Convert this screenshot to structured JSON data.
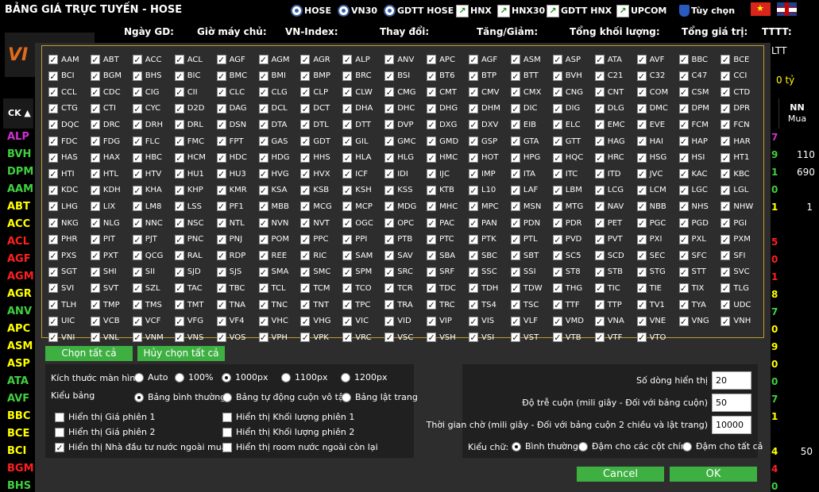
{
  "topbar": {
    "title": "BẢNG GIÁ TRỰC TUYẾN - HOSE",
    "nav": [
      {
        "label": "HOSE",
        "icon": "circle-logo-icon"
      },
      {
        "label": "VN30",
        "icon": "circle-logo-icon"
      },
      {
        "label": "GDTT HOSE",
        "icon": "circle-logo-icon"
      },
      {
        "label": "HNX",
        "icon": "chart-icon"
      },
      {
        "label": "HNX30",
        "icon": "chart-icon"
      },
      {
        "label": "GDTT HNX",
        "icon": "chart-icon"
      },
      {
        "label": "UPCOM",
        "icon": "chart-icon"
      },
      {
        "label": "Tùy chọn",
        "icon": "shield-icon"
      }
    ],
    "flags": [
      "vietnam-flag-icon",
      "uk-flag-icon"
    ]
  },
  "header": {
    "labels": [
      "Ngày GD:",
      "Giờ máy chủ:",
      "VN-Index:",
      "Thay đổi:",
      "Tăng/Giảm:",
      "Tổng khối lượng:",
      "Tổng giá trị:",
      "TTTT:"
    ],
    "ttlt": "LTT",
    "ty": "0 tỷ"
  },
  "logo": {
    "text": "VI"
  },
  "table": {
    "ck_header": "CK ▲",
    "nn_header": "NN",
    "nn_sub": "Mua",
    "rows": [
      {
        "ck": "ALP",
        "color": "#d030d0",
        "n": "7",
        "nc": "#d030d0",
        "v": ""
      },
      {
        "ck": "BVH",
        "color": "#40d040",
        "n": "9",
        "nc": "#40d040",
        "v": "110"
      },
      {
        "ck": "DPM",
        "color": "#40d040",
        "n": "1",
        "nc": "#40d040",
        "v": "690"
      },
      {
        "ck": "AAM",
        "color": "#40d040",
        "n": "0",
        "nc": "#40d040",
        "v": ""
      },
      {
        "ck": "ABT",
        "color": "#ffff00",
        "n": "1",
        "nc": "#ffff00",
        "v": "1"
      },
      {
        "ck": "ACC",
        "color": "#ffff00",
        "n": "",
        "nc": "#ffff00",
        "v": ""
      },
      {
        "ck": "ACL",
        "color": "#ff2020",
        "n": "5",
        "nc": "#ff2020",
        "v": ""
      },
      {
        "ck": "AGF",
        "color": "#ff2020",
        "n": "0",
        "nc": "#ff2020",
        "v": ""
      },
      {
        "ck": "AGM",
        "color": "#ff2020",
        "n": "1",
        "nc": "#ff2020",
        "v": ""
      },
      {
        "ck": "AGR",
        "color": "#ffff00",
        "n": "8",
        "nc": "#ffff00",
        "v": ""
      },
      {
        "ck": "ANV",
        "color": "#40d040",
        "n": "7",
        "nc": "#40d040",
        "v": ""
      },
      {
        "ck": "APC",
        "color": "#ffff00",
        "n": "0",
        "nc": "#ffff00",
        "v": ""
      },
      {
        "ck": "ASM",
        "color": "#ffff00",
        "n": "9",
        "nc": "#ffff00",
        "v": ""
      },
      {
        "ck": "ASP",
        "color": "#ffff00",
        "n": "0",
        "nc": "#ffff00",
        "v": ""
      },
      {
        "ck": "ATA",
        "color": "#40d040",
        "n": "0",
        "nc": "#40d040",
        "v": ""
      },
      {
        "ck": "AVF",
        "color": "#40d040",
        "n": "7",
        "nc": "#40d040",
        "v": ""
      },
      {
        "ck": "BBC",
        "color": "#ffff00",
        "n": "1",
        "nc": "#ffff00",
        "v": ""
      },
      {
        "ck": "BCE",
        "color": "#ffff00",
        "n": "",
        "nc": "#ffff00",
        "v": ""
      },
      {
        "ck": "BCI",
        "color": "#ffff00",
        "n": "4",
        "nc": "#ffff00",
        "v": "50"
      },
      {
        "ck": "BGM",
        "color": "#ff2020",
        "n": "4",
        "nc": "#ff2020",
        "v": ""
      },
      {
        "ck": "BHS",
        "color": "#40d040",
        "n": "0",
        "nc": "#40d040",
        "v": ""
      }
    ]
  },
  "modal": {
    "symbols": [
      "AAM",
      "ABT",
      "ACC",
      "ACL",
      "AGF",
      "AGM",
      "AGR",
      "ALP",
      "ANV",
      "APC",
      "AGF",
      "ASM",
      "ASP",
      "ATA",
      "AVF",
      "BBC",
      "BCE",
      "BCI",
      "BGM",
      "BHS",
      "BIC",
      "BMC",
      "BMI",
      "BMP",
      "BRC",
      "BSI",
      "BT6",
      "BTP",
      "BTT",
      "BVH",
      "C21",
      "C32",
      "C47",
      "CCI",
      "CCL",
      "CDC",
      "CIG",
      "CII",
      "CLC",
      "CLG",
      "CLP",
      "CLW",
      "CMG",
      "CMT",
      "CMV",
      "CMX",
      "CNG",
      "CNT",
      "COM",
      "CSM",
      "CTD",
      "CTG",
      "CTI",
      "CYC",
      "D2D",
      "DAG",
      "DCL",
      "DCT",
      "DHA",
      "DHC",
      "DHG",
      "DHM",
      "DIC",
      "DIG",
      "DLG",
      "DMC",
      "DPM",
      "DPR",
      "DQC",
      "DRC",
      "DRH",
      "DRL",
      "DSN",
      "DTA",
      "DTL",
      "DTT",
      "DVP",
      "DXG",
      "DXV",
      "EIB",
      "ELC",
      "EMC",
      "EVE",
      "FCM",
      "FCN",
      "FDC",
      "FDG",
      "FLC",
      "FMC",
      "FPT",
      "GAS",
      "GDT",
      "GIL",
      "GMC",
      "GMD",
      "GSP",
      "GTA",
      "GTT",
      "HAG",
      "HAI",
      "HAP",
      "HAR",
      "HAS",
      "HAX",
      "HBC",
      "HCM",
      "HDC",
      "HDG",
      "HHS",
      "HLA",
      "HLG",
      "HMC",
      "HOT",
      "HPG",
      "HQC",
      "HRC",
      "HSG",
      "HSI",
      "HT1",
      "HTI",
      "HTL",
      "HTV",
      "HU1",
      "HU3",
      "HVG",
      "HVX",
      "ICF",
      "IDI",
      "IJC",
      "IMP",
      "ITA",
      "ITC",
      "ITD",
      "JVC",
      "KAC",
      "KBC",
      "KDC",
      "KDH",
      "KHA",
      "KHP",
      "KMR",
      "KSA",
      "KSB",
      "KSH",
      "KSS",
      "KTB",
      "L10",
      "LAF",
      "LBM",
      "LCG",
      "LCM",
      "LGC",
      "LGL",
      "LHG",
      "LIX",
      "LM8",
      "LSS",
      "PF1",
      "MBB",
      "MCG",
      "MCP",
      "MDG",
      "MHC",
      "MPC",
      "MSN",
      "MTG",
      "NAV",
      "NBB",
      "NHS",
      "NHW",
      "NKG",
      "NLG",
      "NNC",
      "NSC",
      "NTL",
      "NVN",
      "NVT",
      "OGC",
      "OPC",
      "PAC",
      "PAN",
      "PDN",
      "PDR",
      "PET",
      "PGC",
      "PGD",
      "PGI",
      "PHR",
      "PIT",
      "PJT",
      "PNC",
      "PNJ",
      "POM",
      "PPC",
      "PPI",
      "PTB",
      "PTC",
      "PTK",
      "PTL",
      "PVD",
      "PVT",
      "PXI",
      "PXL",
      "PXM",
      "PXS",
      "PXT",
      "QCG",
      "RAL",
      "RDP",
      "REE",
      "RIC",
      "SAM",
      "SAV",
      "SBA",
      "SBC",
      "SBT",
      "SC5",
      "SCD",
      "SEC",
      "SFC",
      "SFI",
      "SGT",
      "SHI",
      "SII",
      "SJD",
      "SJS",
      "SMA",
      "SMC",
      "SPM",
      "SRC",
      "SRF",
      "SSC",
      "SSI",
      "ST8",
      "STB",
      "STG",
      "STT",
      "SVC",
      "SVI",
      "SVT",
      "SZL",
      "TAC",
      "TBC",
      "TCL",
      "TCM",
      "TCO",
      "TCR",
      "TDC",
      "TDH",
      "TDW",
      "THG",
      "TIC",
      "TIE",
      "TIX",
      "TLG",
      "TLH",
      "TMP",
      "TMS",
      "TMT",
      "TNA",
      "TNC",
      "TNT",
      "TPC",
      "TRA",
      "TRC",
      "TS4",
      "TSC",
      "TTF",
      "TTP",
      "TV1",
      "TYA",
      "UDC",
      "UIC",
      "VCB",
      "VCF",
      "VFG",
      "VF4",
      "VHC",
      "VHG",
      "VIC",
      "VID",
      "VIP",
      "VIS",
      "VLF",
      "VMD",
      "VNA",
      "VNE",
      "VNG",
      "VNH",
      "VNI",
      "VNL",
      "VNM",
      "VNS",
      "VOS",
      "VPH",
      "VPK",
      "VRC",
      "VSC",
      "VSH",
      "VSI",
      "VST",
      "VTB",
      "VTF",
      "VTO"
    ],
    "select_all": "Chọn tất cả",
    "deselect_all": "Hủy chọn tất cả",
    "screen_size_label": "Kích thước màn hình",
    "screen_sizes": [
      "Auto",
      "100%",
      "1000px",
      "1100px",
      "1200px"
    ],
    "screen_size_selected": "1000px",
    "table_type_label": "Kiểu bảng",
    "table_types": [
      "Bảng bình thường",
      "Bảng tự động cuộn vô tận",
      "Bảng lật trang"
    ],
    "table_type_selected": "Bảng bình thường",
    "display_opts": [
      {
        "label": "Hiển thị Giá phiên 1",
        "checked": false
      },
      {
        "label": "Hiển thị Khối lượng phiên 1",
        "checked": false
      },
      {
        "label": "Hiển thị Giá phiên 2",
        "checked": false
      },
      {
        "label": "Hiển thị Khối lượng phiên 2",
        "checked": false
      },
      {
        "label": "Hiển thị Nhà đầu tư nước ngoài mua",
        "checked": true
      },
      {
        "label": "Hiển thị room nước ngoài còn lại",
        "checked": false
      }
    ],
    "rows_label": "Số dòng hiển thị",
    "rows_value": "20",
    "scroll_delay_label": "Độ trễ cuộn (mili giây - Đối với bảng cuộn)",
    "scroll_delay_value": "50",
    "wait_time_label": "Thời gian chờ (mili giây - Đối với bảng cuộn 2 chiều và lật trang)",
    "wait_time_value": "10000",
    "font_style_label": "Kiểu chữ:",
    "font_styles": [
      "Bình thường",
      "Đậm cho các cột chính",
      "Đậm cho tất cả"
    ],
    "font_style_selected": "Bình thường",
    "cancel": "Cancel",
    "ok": "OK"
  }
}
